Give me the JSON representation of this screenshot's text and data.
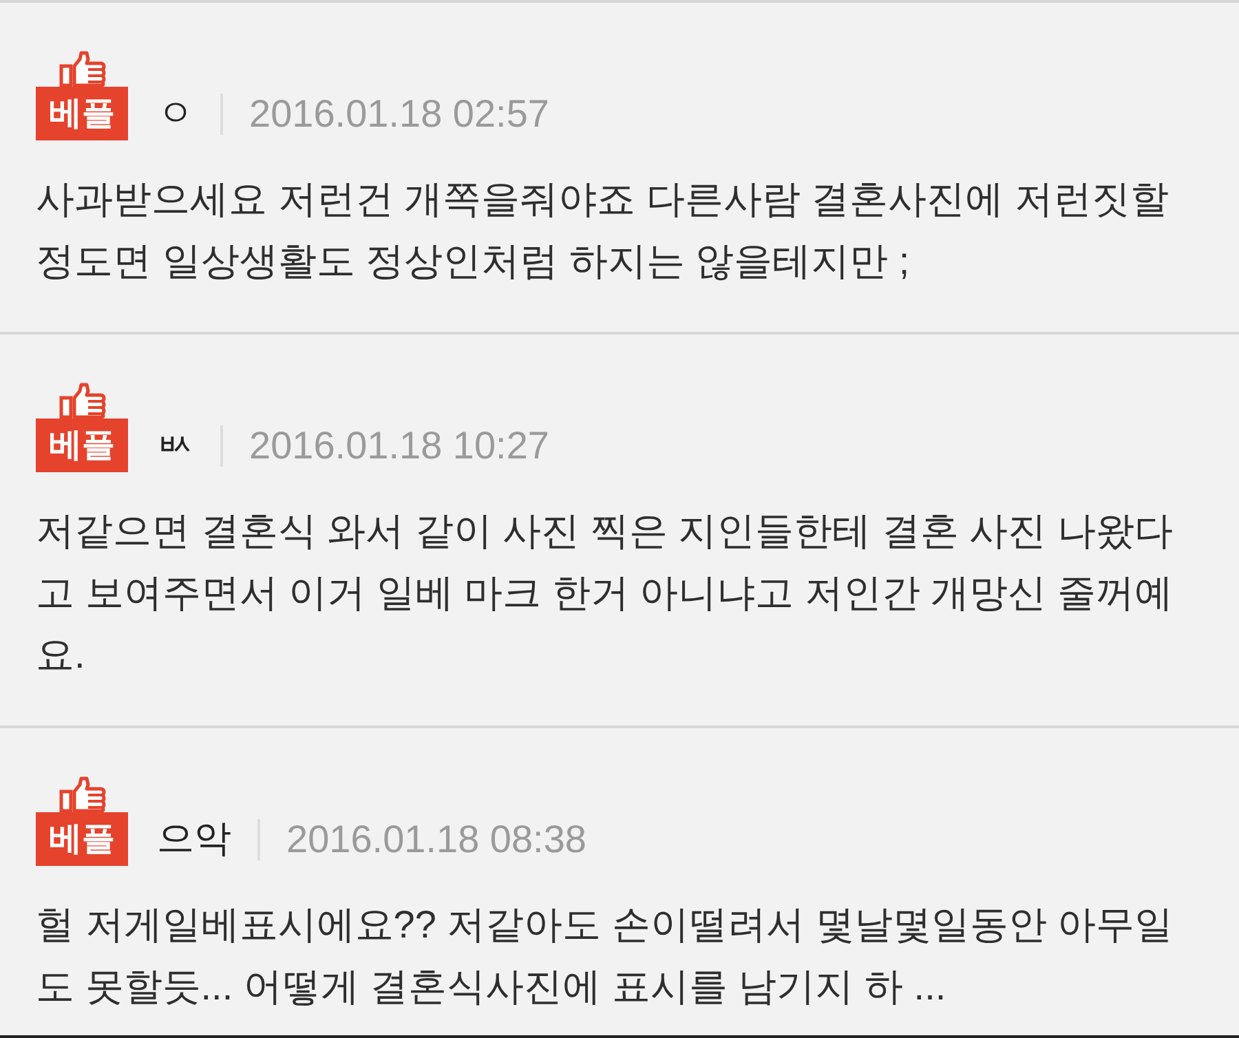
{
  "comments": [
    {
      "badge": "베플",
      "author": "ㅇ",
      "date": "2016.01.18 02:57",
      "text": "사과받으세요 저런건 개쪽을줘야죠 다른사람 결혼사진에 저런짓할 정도면 일상생활도 정상인처럼 하지는 않을테지만 ;"
    },
    {
      "badge": "베플",
      "author": "ㅄ",
      "date": "2016.01.18 10:27",
      "text": "저같으면 결혼식 와서 같이 사진 찍은 지인들한테 결혼 사진 나왔다고 보여주면서 이거 일베 마크 한거 아니냐고 저인간 개망신 줄꺼예요."
    },
    {
      "badge": "베플",
      "author": "으악",
      "date": "2016.01.18 08:38",
      "text": "헐 저게일베표시에요?? 저같아도 손이떨려서 몇날몇일동안 아무일도 못할듯... 어떻게 결혼식사진에 표시를 남기지 하 ..."
    }
  ]
}
